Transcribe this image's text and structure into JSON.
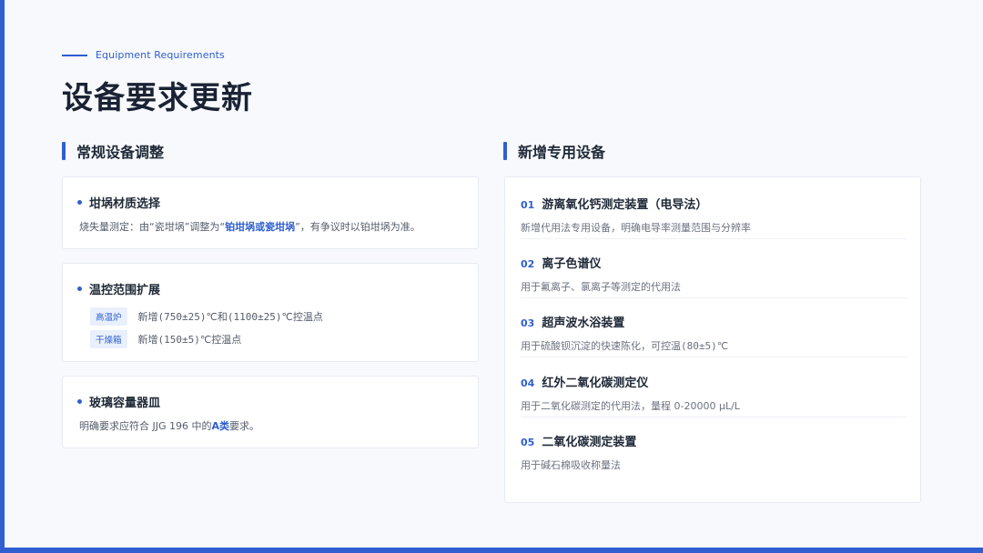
{
  "header": {
    "eyebrow": "Equipment Requirements",
    "title": "设备要求更新"
  },
  "left_section": {
    "heading": "常规设备调整",
    "cards": [
      {
        "title": "坩埚材质选择",
        "body_prefix": "烧失量测定：由“瓷坩埚”调整为“",
        "body_highlight": "铂坩埚或瓷坩埚",
        "body_suffix": "”，有争议时以铂坩埚为准。"
      },
      {
        "title": "温控范围扩展",
        "rows": [
          {
            "tag": "高温炉",
            "t1": "新增",
            "v1": "(750±25)",
            "t2": "℃和",
            "v2": "(1100±25)",
            "t3": "℃控温点"
          },
          {
            "tag": "干燥箱",
            "t1": "新增",
            "v1": "(150±5)",
            "t2": "℃控温点"
          }
        ]
      },
      {
        "title": "玻璃容量器皿",
        "body_prefix": "明确要求应符合 JJG 196 中的",
        "body_highlight": "A类",
        "body_suffix": "要求。"
      }
    ]
  },
  "right_section": {
    "heading": "新增专用设备",
    "items": [
      {
        "num": "01",
        "title": "游离氧化钙测定装置（电导法）",
        "desc": "新增代用法专用设备，明确电导率测量范围与分辨率"
      },
      {
        "num": "02",
        "title": "离子色谱仪",
        "desc": "用于氟离子、氯离子等测定的代用法"
      },
      {
        "num": "03",
        "title": "超声波水浴装置",
        "desc_prefix": "用于硫酸钡沉淀的快速陈化，可控温",
        "desc_mono": "(80±5)",
        "desc_suffix": "℃"
      },
      {
        "num": "04",
        "title": "红外二氧化碳测定仪",
        "desc": "用于二氧化碳测定的代用法，量程 0-20000 μL/L"
      },
      {
        "num": "05",
        "title": "二氧化碳测定装置",
        "desc": "用于碱石棉吸收称量法"
      }
    ]
  },
  "colors": {
    "accent": "#2f5fd0",
    "background": "#f7f9fc",
    "card": "#ffffff",
    "tag_bg": "#e9f0fc"
  }
}
